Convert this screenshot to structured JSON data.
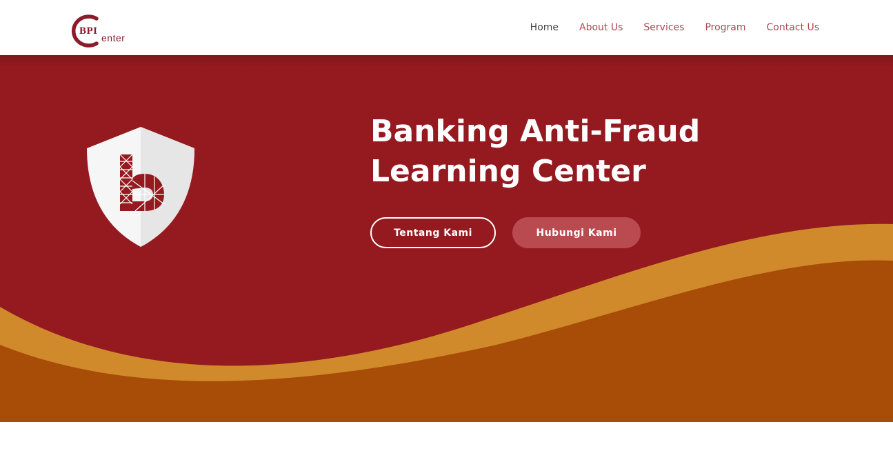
{
  "brand": {
    "logo_primary": "BPI",
    "logo_secondary": "enter",
    "accent_color": "#8a1c2c"
  },
  "nav": {
    "items": [
      {
        "label": "Home",
        "active": true
      },
      {
        "label": "About Us",
        "active": false
      },
      {
        "label": "Services",
        "active": false
      },
      {
        "label": "Program",
        "active": false
      },
      {
        "label": "Contact Us",
        "active": false
      }
    ]
  },
  "hero": {
    "title_line1": "Banking Anti-Fraud",
    "title_line2": "Learning Center",
    "primary_button": "Tentang Kami",
    "secondary_button": "Hubungi Kami",
    "background_color": "#941a20",
    "wave_colors": [
      "#d08a2b",
      "#a84d08"
    ],
    "icon": "shield-logo-icon"
  }
}
